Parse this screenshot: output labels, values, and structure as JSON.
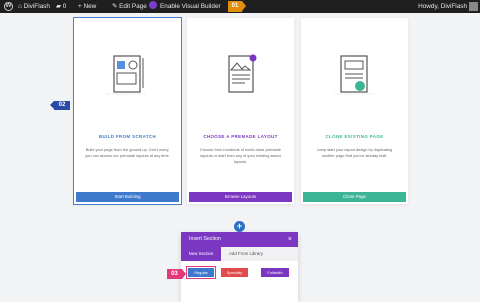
{
  "adminbar": {
    "site_name": "DiviFlash",
    "comments": "0",
    "new_label": "+ New",
    "edit_page": "Edit Page",
    "enable_vb": "Enable Visual Builder",
    "step_badge": "01",
    "howdy": "Howdy, DiviFlash"
  },
  "step2_badge": "02",
  "step3_badge": "03",
  "cards": [
    {
      "title": "BUILD FROM SCRATCH",
      "desc": "Build your page from the ground up. Don't worry, you can access our premade layouts at any time.",
      "button": "Start Building",
      "color": "#3f79cc"
    },
    {
      "title": "CHOOSE A PREMADE LAYOUT",
      "desc": "Choose from hundreds of world-class premade layouts or start from any of your existing saved layouts.",
      "button": "Browse Layouts",
      "color": "#7b36c2"
    },
    {
      "title": "CLONE EXISTING PAGE",
      "desc": "Jump start your layout design by duplicating another page that you've already built.",
      "button": "Clone Page",
      "color": "#3cb596"
    }
  ],
  "modal": {
    "title": "Insert Section",
    "close": "×",
    "tabs": [
      "New Section",
      "Add From Library"
    ],
    "buttons": [
      "Regular",
      "Specialty",
      "Fullwidth"
    ]
  },
  "colors": {
    "blue": "#3f79cc",
    "purple": "#7b36c2",
    "green": "#3cb596",
    "pink": "#e2397a",
    "orange": "#e08e0b"
  }
}
